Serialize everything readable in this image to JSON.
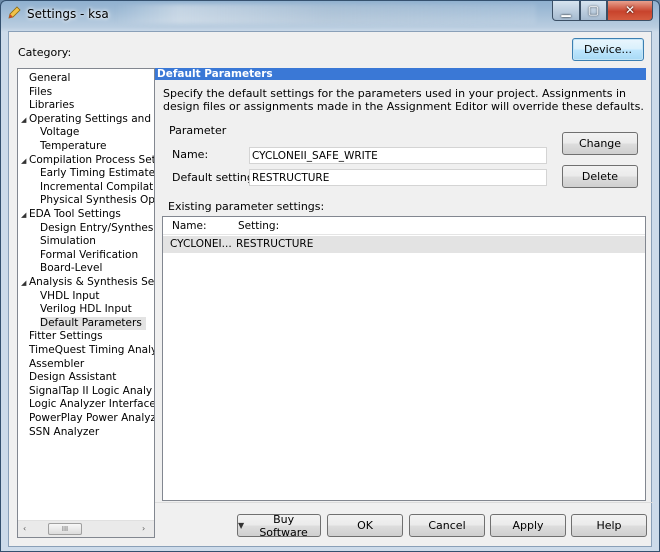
{
  "window": {
    "title": "Settings - ksa",
    "controls": {
      "minimize": "▁",
      "maximize": "▢",
      "close": "✕"
    }
  },
  "category_label": "Category:",
  "device_button": "Device...",
  "tree": {
    "items": [
      {
        "label": "General",
        "level": 0,
        "arrow": ""
      },
      {
        "label": "Files",
        "level": 0,
        "arrow": ""
      },
      {
        "label": "Libraries",
        "level": 0,
        "arrow": ""
      },
      {
        "label": "Operating Settings and (",
        "level": 0,
        "arrow": "◢"
      },
      {
        "label": "Voltage",
        "level": 1,
        "arrow": ""
      },
      {
        "label": "Temperature",
        "level": 1,
        "arrow": ""
      },
      {
        "label": "Compilation Process Sett",
        "level": 0,
        "arrow": "◢"
      },
      {
        "label": "Early Timing Estimate",
        "level": 1,
        "arrow": ""
      },
      {
        "label": "Incremental Compilatio",
        "level": 1,
        "arrow": ""
      },
      {
        "label": "Physical Synthesis Opt",
        "level": 1,
        "arrow": ""
      },
      {
        "label": "EDA Tool Settings",
        "level": 0,
        "arrow": "◢"
      },
      {
        "label": "Design Entry/Synthesis",
        "level": 1,
        "arrow": ""
      },
      {
        "label": "Simulation",
        "level": 1,
        "arrow": ""
      },
      {
        "label": "Formal Verification",
        "level": 1,
        "arrow": ""
      },
      {
        "label": "Board-Level",
        "level": 1,
        "arrow": ""
      },
      {
        "label": "Analysis & Synthesis Sett",
        "level": 0,
        "arrow": "◢"
      },
      {
        "label": "VHDL Input",
        "level": 1,
        "arrow": ""
      },
      {
        "label": "Verilog HDL Input",
        "level": 1,
        "arrow": ""
      },
      {
        "label": "Default Parameters",
        "level": 1,
        "arrow": "",
        "selected": true
      },
      {
        "label": "Fitter Settings",
        "level": 0,
        "arrow": ""
      },
      {
        "label": "TimeQuest Timing Analy",
        "level": 0,
        "arrow": ""
      },
      {
        "label": "Assembler",
        "level": 0,
        "arrow": ""
      },
      {
        "label": "Design Assistant",
        "level": 0,
        "arrow": ""
      },
      {
        "label": "SignalTap II Logic Analy",
        "level": 0,
        "arrow": ""
      },
      {
        "label": "Logic Analyzer Interface",
        "level": 0,
        "arrow": ""
      },
      {
        "label": "PowerPlay Power Analyz",
        "level": 0,
        "arrow": ""
      },
      {
        "label": "SSN Analyzer",
        "level": 0,
        "arrow": ""
      }
    ],
    "scroll": {
      "left": "‹",
      "right": "›",
      "thumb": "III"
    }
  },
  "panel": {
    "header": "Default Parameters",
    "description": "Specify the default settings for the parameters used in your project.  Assignments in design files or assignments made in the Assignment Editor will override these defaults.",
    "parameter_group": "Parameter",
    "name_label": "Name:",
    "name_value": "CYCLONEII_SAFE_WRITE",
    "default_label": "Default setting:",
    "default_value": "RESTRUCTURE",
    "change_button": "Change",
    "delete_button": "Delete",
    "existing_label": "Existing parameter settings:",
    "columns": {
      "name": "Name:",
      "setting": "Setting:"
    },
    "rows": [
      {
        "name": "CYCLONEI...",
        "setting": "RESTRUCTURE"
      }
    ]
  },
  "footer": {
    "buy_arrow": "▼",
    "buy": "Buy Software",
    "ok": "OK",
    "cancel": "Cancel",
    "apply": "Apply",
    "help": "Help"
  }
}
